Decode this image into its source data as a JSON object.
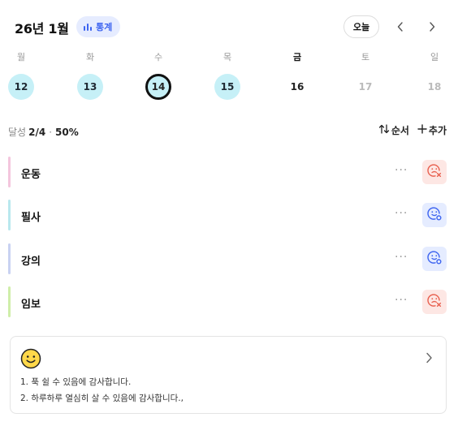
{
  "header": {
    "month_title": "26년 1월",
    "stats_label": "통계",
    "today_label": "오늘",
    "prev_icon": "chevron-left-icon",
    "next_icon": "chevron-right-icon"
  },
  "week": {
    "days": [
      {
        "dow": "월",
        "date": "12",
        "state": "done"
      },
      {
        "dow": "화",
        "date": "13",
        "state": "done"
      },
      {
        "dow": "수",
        "date": "14",
        "state": "today"
      },
      {
        "dow": "목",
        "date": "15",
        "state": "done"
      },
      {
        "dow": "금",
        "date": "16",
        "state": "plain"
      },
      {
        "dow": "토",
        "date": "17",
        "state": "future"
      },
      {
        "dow": "일",
        "date": "18",
        "state": "future"
      }
    ]
  },
  "summary": {
    "label": "달성",
    "fraction": "2/4",
    "separator": "·",
    "percent": "50%"
  },
  "toolbar": {
    "order_label": "순서",
    "add_label": "추가"
  },
  "habits": [
    {
      "name": "운동",
      "color": "#f4c6dd",
      "status": "fail",
      "more": "···"
    },
    {
      "name": "필사",
      "color": "#b9e8ee",
      "status": "ok",
      "more": "···"
    },
    {
      "name": "강의",
      "color": "#c9d2f2",
      "status": "ok",
      "more": "···"
    },
    {
      "name": "임보",
      "color": "#cfeea9",
      "status": "fail",
      "more": "···"
    }
  ],
  "gratitude": {
    "icon": "smiley-icon",
    "lines": [
      "1. 푹 쉴 수 있음에 감사합니다.",
      "2. 하루하루 열심히 살 수 있음에 감사합니다.,"
    ]
  },
  "colors": {
    "accent": "#3d64f0",
    "done_circle": "#c6f0f7",
    "fail_bg": "#fde7e4",
    "fail_fg": "#e8604f",
    "ok_bg": "#e5ecff",
    "ok_fg": "#3d64f0"
  }
}
